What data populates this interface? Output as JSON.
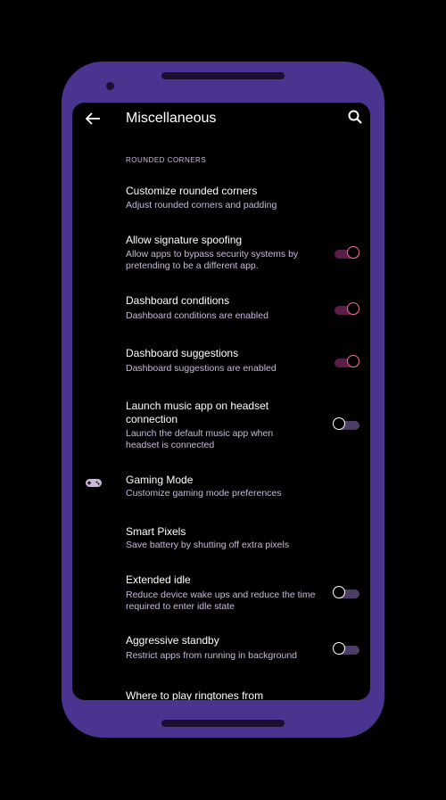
{
  "appbar": {
    "title": "Miscellaneous",
    "back_icon": "arrow-back-icon",
    "search_icon": "search-icon"
  },
  "section": {
    "header": "ROUNDED CORNERS"
  },
  "items": [
    {
      "title": "Customize rounded corners",
      "subtitle": "Adjust rounded corners and padding"
    },
    {
      "title": "Allow signature spoofing",
      "subtitle": "Allow apps to bypass security systems by pretending to be a different app.",
      "toggle": "on"
    },
    {
      "title": "Dashboard conditions",
      "subtitle": "Dashboard conditions are enabled",
      "toggle": "on"
    },
    {
      "title": "Dashboard suggestions",
      "subtitle": "Dashboard suggestions are enabled",
      "toggle": "on"
    },
    {
      "title": "Launch music app on headset connection",
      "subtitle": "Launch the default music app when headset is connected",
      "toggle": "off"
    },
    {
      "title": "Gaming Mode",
      "subtitle": "Customize gaming mode preferences",
      "icon": "gamepad-icon"
    },
    {
      "title": "Smart Pixels",
      "subtitle": "Save battery by shutting off extra pixels"
    },
    {
      "title": "Extended idle",
      "subtitle": "Reduce device wake ups and reduce the time required to enter idle state",
      "toggle": "off"
    },
    {
      "title": "Aggressive standby",
      "subtitle": "Restrict apps from running in background",
      "toggle": "off"
    },
    {
      "title": "Where to play ringtones from"
    }
  ],
  "colors": {
    "phone_frame": "#4a3490",
    "screen": "#000000",
    "title_text": "#ffffff",
    "subtitle_text": "#c9b8da",
    "toggle_on_thumb": "#f06a9a",
    "toggle_on_track": "#5a1e46",
    "toggle_off_track": "#4d3c66"
  }
}
